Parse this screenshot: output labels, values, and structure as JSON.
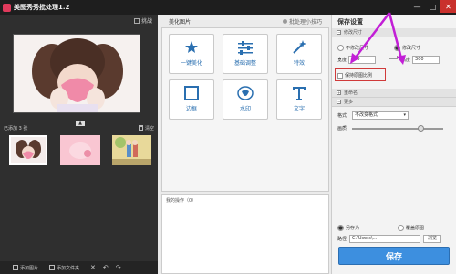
{
  "window": {
    "title": "美图秀秀批处理1.2",
    "min_glyph": "—",
    "max_glyph": "□",
    "close_glyph": "✕"
  },
  "left": {
    "batch_label": "挑战",
    "added_label": "已添加 3 张",
    "clear_label": "清空",
    "collapse_glyph": "▲",
    "toolbar": {
      "add_image": "添加图片",
      "add_folder": "添加文件夹",
      "delete_glyph": "✕",
      "rotate_left_glyph": "↶",
      "rotate_right_glyph": "↷"
    }
  },
  "center": {
    "tab_title": "美化图片",
    "tip_label": "批处理小技巧",
    "tools": [
      {
        "label": "一键美化",
        "icon": "magic-wand-icon"
      },
      {
        "label": "基础调整",
        "icon": "sliders-icon"
      },
      {
        "label": "特效",
        "icon": "sparkle-wand-icon"
      },
      {
        "label": "边框",
        "icon": "frame-icon"
      },
      {
        "label": "水印",
        "icon": "watermark-icon"
      },
      {
        "label": "文字",
        "icon": "text-icon"
      }
    ],
    "ops_label": "我的操作（0）"
  },
  "right": {
    "heading": "保存设置",
    "size_section": "修改尺寸",
    "no_resize_label": "不修改尺寸",
    "resize_label": "修改尺寸",
    "width_label": "宽度",
    "width_value": "500",
    "height_label": "高度",
    "height_value": "300",
    "keep_ratio_label": "保持原图比例",
    "rename_section": "重命名",
    "more_section": "更多",
    "format_label": "格式",
    "format_value": "不改变格式",
    "quality_label": "画质",
    "quality_fraction": 0.75,
    "save_as_label": "另存为",
    "overwrite_label": "覆盖原图",
    "path_label": "路径",
    "path_value": "C:\\Users\\...",
    "browse_label": "浏览",
    "save_button": "保存"
  },
  "colors": {
    "annotation_red": "#d03a3a",
    "annotation_purple": "#c21fd6",
    "save_blue": "#3d8fdf",
    "tool_blue": "#2a6fb0"
  }
}
